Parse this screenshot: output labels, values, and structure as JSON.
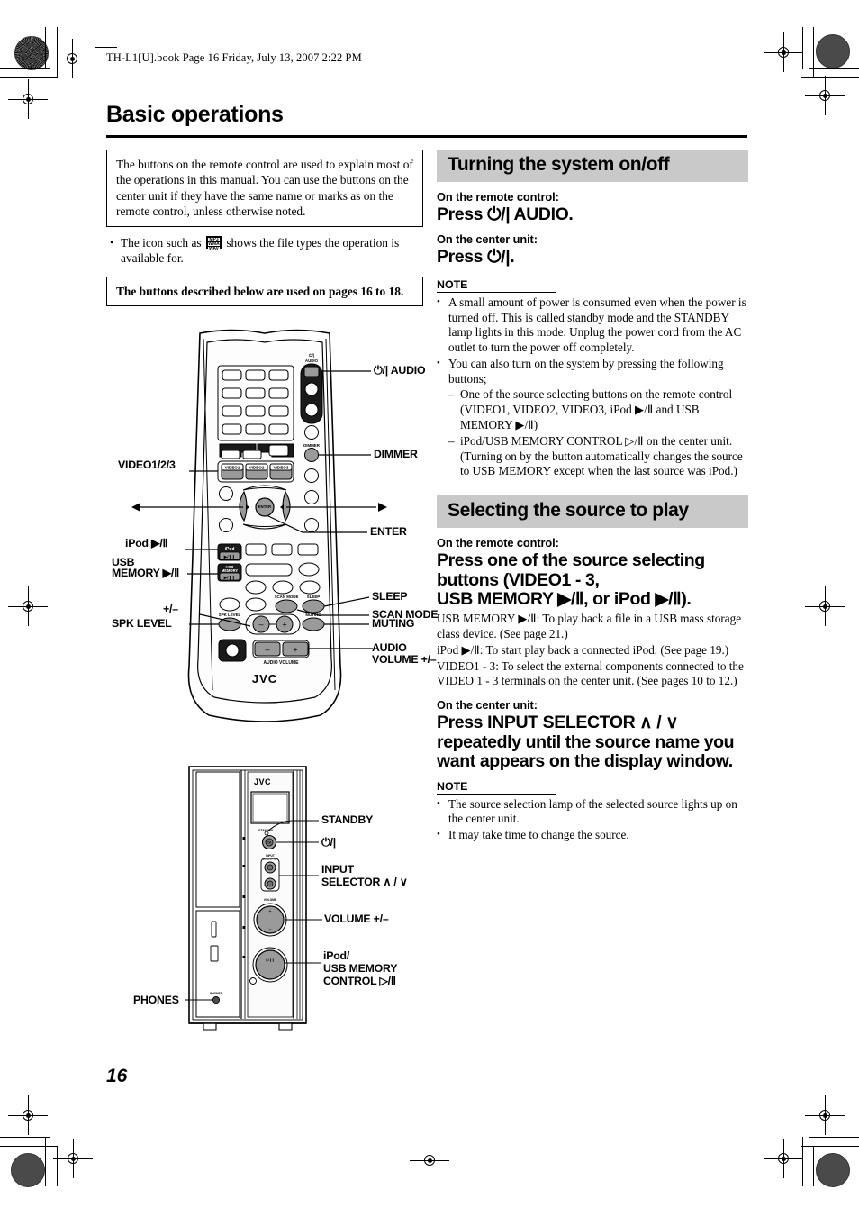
{
  "meta": {
    "running_head": "TH-L1[U].book  Page 16  Friday, July 13, 2007  2:22 PM",
    "page_number": "16",
    "page_title": "Basic operations"
  },
  "left_column": {
    "intro_box": "The buttons on the remote control are used to explain most of the operations in this manual. You can use the buttons on the center unit if they have the same name or marks as on the remote control, unless otherwise noted.",
    "bullet_before_icon": "The icon such as",
    "icon_lines": [
      "MP3",
      "WMA",
      "WAV"
    ],
    "bullet_after_icon": "shows the file types the operation is available for.",
    "pages_box": "The buttons described below are used on pages 16 to 18."
  },
  "right_column": {
    "section1": {
      "heading": "Turning the system on/off",
      "on_remote_label": "On the remote control:",
      "press_remote": "Press ⏻/| AUDIO.",
      "on_center_label": "On the center unit:",
      "press_center": "Press ⏻/|.",
      "note_label": "NOTE",
      "notes": [
        {
          "text": "A small amount of power is consumed even when the power is turned off. This is called standby mode and the STANDBY lamp lights in this mode. Unplug the power cord from the AC outlet to turn the power off completely.",
          "sub": []
        },
        {
          "text": "You can also turn on the system by pressing the following buttons;",
          "sub": [
            "One of the source selecting buttons on the remote control (VIDEO1, VIDEO2, VIDEO3, iPod ▶/Ⅱ and USB MEMORY ▶/Ⅱ)",
            "iPod/USB MEMORY CONTROL ▷/Ⅱ on the center unit. (Turning on by the button automatically changes the source to USB MEMORY except when the last source was iPod.)"
          ]
        }
      ]
    },
    "section2": {
      "heading": "Selecting the source to play",
      "on_remote_label": "On the remote control:",
      "press_remote_l1": "Press one of the source selecting",
      "press_remote_l2": "buttons (VIDEO1 - 3,",
      "press_remote_l3": "USB MEMORY ▶/Ⅱ, or iPod ▶/Ⅱ).",
      "body": [
        "USB MEMORY ▶/Ⅱ: To play back a file in a USB mass storage class device. (See page 21.)",
        "iPod ▶/Ⅱ: To start play back a connected iPod. (See page 19.)",
        "VIDEO1 - 3: To select the external components connected to the VIDEO 1 - 3 terminals on the center unit. (See pages 10 to 12.)"
      ],
      "on_center_label": "On the center unit:",
      "press_center_l1": "Press INPUT SELECTOR ∧ / ∨",
      "press_center_l2": "repeatedly until the source name you",
      "press_center_l3": "want appears on the display window.",
      "note_label": "NOTE",
      "notes": [
        "The source selection lamp of the selected source lights up on the center unit.",
        "It may take time to change the source."
      ]
    }
  },
  "remote_diagram": {
    "brand": "JVC",
    "keycaps": {
      "video1": "VIDEO1",
      "video2": "VIDEO2",
      "video3": "VIDEO3",
      "ipod_top": "iPod",
      "ipod_bottom": "▶/Ⅱ",
      "usb_top": "USB MEMORY",
      "usb_bottom": "▶/Ⅱ",
      "power_top": "⏻/|",
      "power_bottom": "AUDIO",
      "dimmer": "DIMMER",
      "scan_mode": "SCAN MODE",
      "sleep": "SLEEP",
      "muting": "MUTING",
      "spk_level": "SPK LEVEL",
      "enter": "ENTER",
      "audio_volume": "AUDIO VOLUME",
      "minus": "–",
      "plus": "+"
    },
    "callouts_left": [
      {
        "label": "VIDEO1/2/3"
      },
      {
        "label": "◀"
      },
      {
        "label": "iPod ▶/Ⅱ"
      },
      {
        "label": "USB"
      },
      {
        "label": "MEMORY ▶/Ⅱ"
      },
      {
        "label": "+/–"
      },
      {
        "label": "SPK LEVEL"
      }
    ],
    "callouts_right": [
      {
        "label": "⏻/| AUDIO"
      },
      {
        "label": "DIMMER"
      },
      {
        "label": "▶"
      },
      {
        "label": "ENTER"
      },
      {
        "label": "SLEEP"
      },
      {
        "label": "SCAN MODE"
      },
      {
        "label": "MUTING"
      },
      {
        "label": "AUDIO"
      },
      {
        "label": "VOLUME +/–"
      }
    ]
  },
  "center_unit_diagram": {
    "brand": "JVC",
    "micro_labels": {
      "standby": "STANDBY",
      "input_selector": "INPUT SELECTOR",
      "volume": "VOLUME",
      "phones": "PHONES"
    },
    "callouts_right": [
      {
        "label": "STANDBY"
      },
      {
        "label": "⏻/|"
      },
      {
        "label": "INPUT"
      },
      {
        "label": "SELECTOR ∧ / ∨"
      },
      {
        "label": "VOLUME +/–"
      },
      {
        "label": "iPod/"
      },
      {
        "label": "USB MEMORY"
      },
      {
        "label": "CONTROL ▷/Ⅱ"
      }
    ],
    "callouts_left": [
      {
        "label": "PHONES"
      }
    ]
  }
}
